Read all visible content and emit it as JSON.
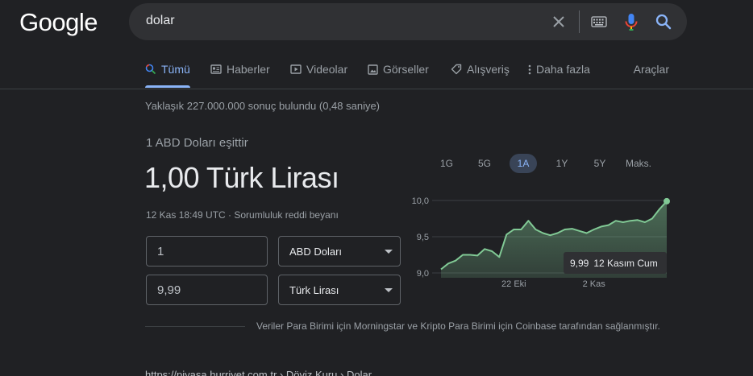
{
  "logo": "Google",
  "search": {
    "query": "dolar"
  },
  "tabs": [
    {
      "label": "Tümü",
      "icon": "search-icon"
    },
    {
      "label": "Haberler",
      "icon": "news-icon"
    },
    {
      "label": "Videolar",
      "icon": "video-icon"
    },
    {
      "label": "Görseller",
      "icon": "image-icon"
    },
    {
      "label": "Alışveriş",
      "icon": "tag-icon"
    },
    {
      "label": "Daha fazla",
      "icon": "more-vert-icon"
    }
  ],
  "tools_label": "Araçlar",
  "stats": "Yaklaşık 227.000.000 sonuç bulundu (0,48 saniye)",
  "converter": {
    "equals_text": "1 ABD Doları eşittir",
    "result_text": "1,00 Türk Lirası",
    "meta": "12 Kas 18:49 UTC · Sorumluluk reddi beyanı",
    "from_amount": "1",
    "from_currency": "ABD Doları",
    "to_amount": "9,99",
    "to_currency": "Türk Lirası"
  },
  "ranges": [
    {
      "label": "1G",
      "active": false
    },
    {
      "label": "5G",
      "active": false
    },
    {
      "label": "1A",
      "active": true
    },
    {
      "label": "1Y",
      "active": false
    },
    {
      "label": "5Y",
      "active": false
    },
    {
      "label": "Maks.",
      "active": false
    }
  ],
  "tooltip": {
    "value": "9,99",
    "date": "12 Kasım Cum"
  },
  "colors": {
    "line": "#81c995",
    "accent": "#8ab4f8",
    "background": "#202124"
  },
  "chart_data": {
    "type": "area",
    "y_ticks": [
      "10,0",
      "9,5",
      "9,0"
    ],
    "x_ticks": [
      {
        "label": "22 Eki",
        "x": 10
      },
      {
        "label": "2 Kas",
        "x": 21
      }
    ],
    "ylim": [
      9.0,
      10.0
    ],
    "xlim": [
      0,
      31
    ],
    "x": [
      0,
      1,
      2,
      3,
      4,
      5,
      6,
      7,
      8,
      9,
      10,
      11,
      12,
      13,
      14,
      15,
      16,
      17,
      18,
      19,
      20,
      21,
      22,
      23,
      24,
      25,
      26,
      27,
      28,
      29,
      30,
      31
    ],
    "values": [
      9.05,
      9.13,
      9.17,
      9.25,
      9.25,
      9.24,
      9.33,
      9.3,
      9.22,
      9.53,
      9.6,
      9.6,
      9.72,
      9.6,
      9.55,
      9.52,
      9.55,
      9.6,
      9.61,
      9.58,
      9.55,
      9.6,
      9.64,
      9.66,
      9.72,
      9.7,
      9.72,
      9.73,
      9.7,
      9.75,
      9.88,
      9.99
    ]
  },
  "attribution": "Veriler Para Birimi için Morningstar ve Kripto Para Birimi için Coinbase tarafından sağlanmıştır.",
  "next_result": "https://piyasa.hurriyet.com.tr › Döviz Kuru › Dolar"
}
